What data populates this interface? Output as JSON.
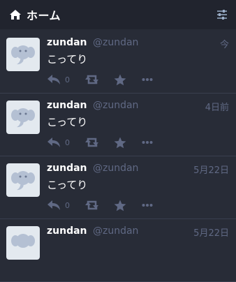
{
  "header": {
    "title": "ホーム"
  },
  "statuses": [
    {
      "display_name": "zundan",
      "acct": "@zundan",
      "time": "今",
      "content": "こってり",
      "reply_count": "0"
    },
    {
      "display_name": "zundan",
      "acct": "@zundan",
      "time": "4日前",
      "content": "こってり",
      "reply_count": "0"
    },
    {
      "display_name": "zundan",
      "acct": "@zundan",
      "time": "5月22日",
      "content": "こってり",
      "reply_count": "0"
    },
    {
      "display_name": "zundan",
      "acct": "@zundan",
      "time": "5月22日",
      "content": "",
      "reply_count": ""
    }
  ],
  "colors": {
    "background": "#282c37",
    "header_background": "#21242e",
    "text": "#ffffff",
    "muted": "#606984",
    "divider": "#393f4f"
  },
  "icons": {
    "header": "home-icon",
    "settings": "sliders-icon",
    "avatar": "elephant-icon",
    "reply": "reply-icon",
    "boost": "boost-icon",
    "favourite": "star-icon",
    "more": "ellipsis-icon"
  }
}
